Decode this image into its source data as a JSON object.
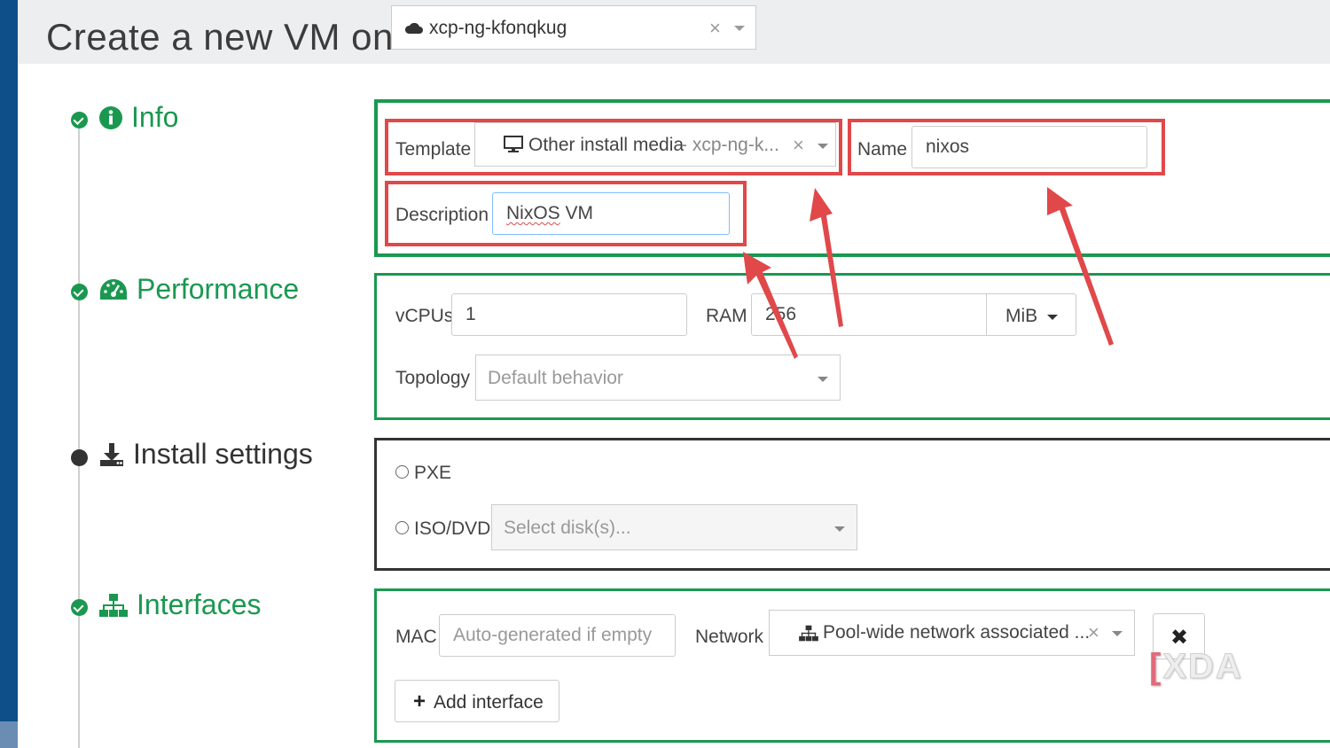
{
  "header": {
    "title": "Create a new VM on",
    "pool": {
      "value": "xcp-ng-kfonqkug",
      "icon": "cloud-icon"
    }
  },
  "steps": [
    {
      "label": "Info",
      "icon": "info-circle-icon",
      "state": "done"
    },
    {
      "label": "Performance",
      "icon": "dashboard-icon",
      "state": "done"
    },
    {
      "label": "Install settings",
      "icon": "download-icon",
      "state": "pending"
    },
    {
      "label": "Interfaces",
      "icon": "network-icon",
      "state": "done"
    }
  ],
  "info": {
    "template_label": "Template",
    "template_value": "Other install media",
    "template_pool": " - xcp-ng-k...",
    "name_label": "Name",
    "name_value": "nixos",
    "description_label": "Description",
    "description_value_word": "NixOS",
    "description_value_rest": " VM"
  },
  "performance": {
    "vcpus_label": "vCPUs",
    "vcpus_value": "1",
    "ram_label": "RAM",
    "ram_value": "256",
    "ram_unit": "MiB",
    "topology_label": "Topology",
    "topology_placeholder": "Default behavior"
  },
  "install": {
    "pxe_label": "PXE",
    "iso_label": "ISO/DVD",
    "disk_placeholder": "Select disk(s)..."
  },
  "interfaces": {
    "mac_label": "MAC",
    "mac_placeholder": "Auto-generated if empty",
    "network_label": "Network",
    "network_value": "Pool-wide network associated ...",
    "add_interface_label": "Add interface"
  },
  "watermark": {
    "text": "XDA"
  },
  "colors": {
    "accent_green": "#1a9850",
    "highlight_red": "#e0484a",
    "sidebar_blue": "#0e4f8a",
    "header_grey": "#eceeef"
  }
}
